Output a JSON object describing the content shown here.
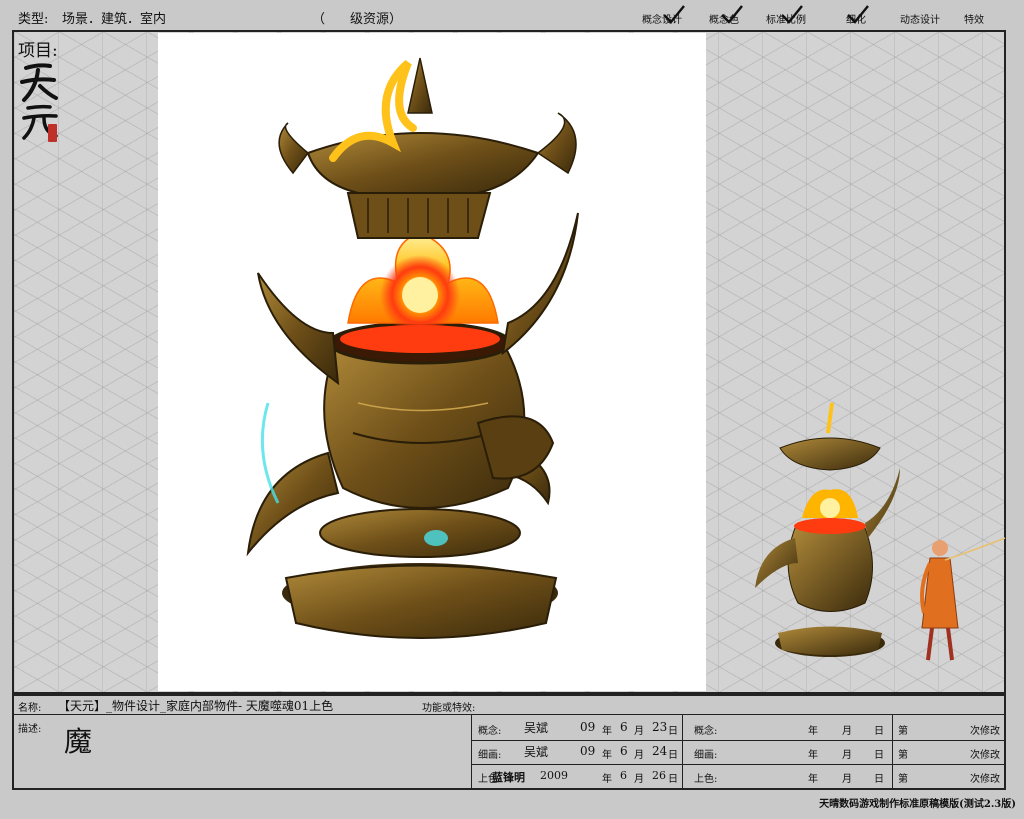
{
  "header": {
    "type_label": "类型:",
    "categories": "场景．建筑．室内",
    "resource_level_open": "（",
    "resource_level": "级资源）",
    "steps": [
      "概念设计",
      "概念色",
      "标准比例",
      "细化",
      "动态设计",
      "特效"
    ],
    "completed_steps": 4
  },
  "project": {
    "label": "项目:",
    "logo_text": "天元"
  },
  "info": {
    "name_label": "名称:",
    "name_value": "【天元】_物件设计_家庭内部物件- 天魔噬魂01上色",
    "function_label": "功能或特效:",
    "desc_label": "描述:",
    "desc_value": "魔",
    "rows_left": [
      {
        "label": "概念:",
        "person": "吴斌",
        "year": "09",
        "y_unit": "年",
        "month": "6",
        "m_unit": "月",
        "day": "23",
        "d_unit": "日"
      },
      {
        "label": "细画:",
        "person": "吴斌",
        "year": "09",
        "y_unit": "年",
        "month": "6",
        "m_unit": "月",
        "day": "24",
        "d_unit": "日"
      },
      {
        "label": "上色:",
        "person": "蓝锋明",
        "year": "2009",
        "y_unit": "年",
        "month": "6",
        "m_unit": "月",
        "day": "26",
        "d_unit": "日"
      }
    ],
    "rows_mid": [
      {
        "label": "概念:",
        "y_unit": "年",
        "m_unit": "月",
        "d_unit": "日"
      },
      {
        "label": "细画:",
        "y_unit": "年",
        "m_unit": "月",
        "d_unit": "日"
      },
      {
        "label": "上色:",
        "y_unit": "年",
        "m_unit": "月",
        "d_unit": "日"
      }
    ],
    "rows_right": [
      {
        "label": "第",
        "suffix": "次修改"
      },
      {
        "label": "第",
        "suffix": "次修改"
      },
      {
        "label": "第",
        "suffix": "次修改"
      }
    ]
  },
  "footer": {
    "template_note": "天晴数码游戏制作标准原稿模版(测试2.3版)"
  },
  "colors": {
    "frame_bg": "#d3d3d3",
    "border": "#222222",
    "bronze": "#7a5a1e",
    "flame": "#ffb400",
    "glow": "#ff3b10",
    "seal_red": "#c0302a"
  }
}
